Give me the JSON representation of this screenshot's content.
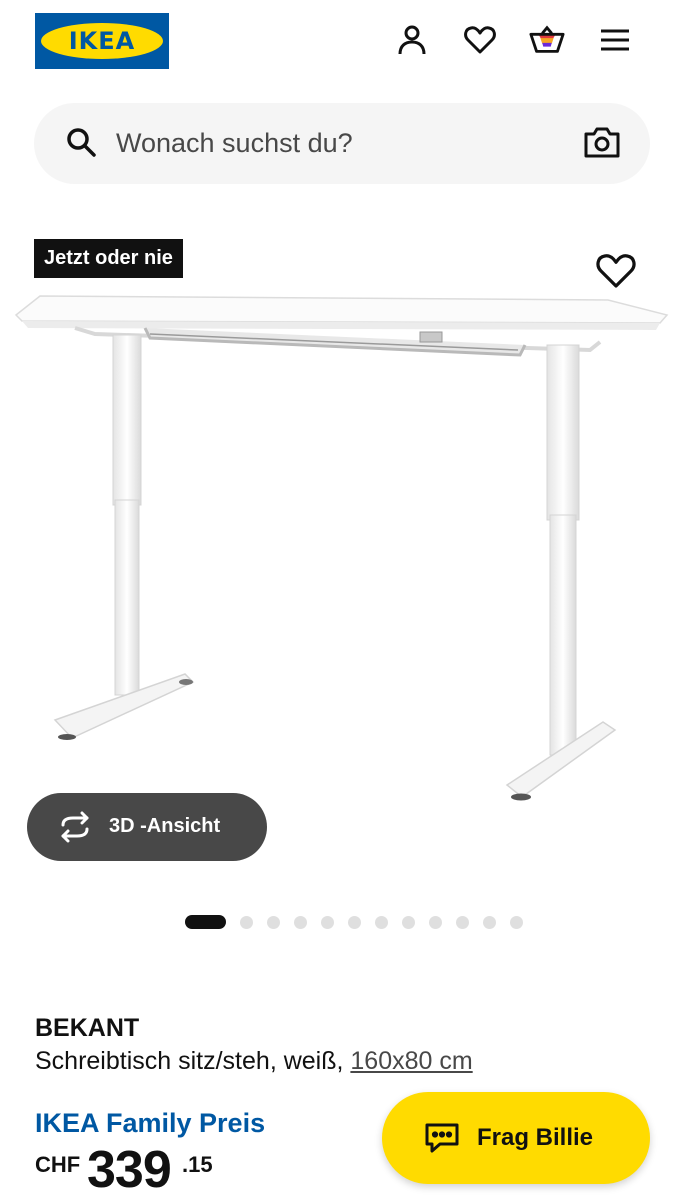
{
  "header": {
    "logo_text": "IKEA",
    "icons": [
      "account-icon",
      "wishlist-heart-icon",
      "cart-icon",
      "menu-icon"
    ]
  },
  "search": {
    "placeholder": "Wonach suchst du?"
  },
  "product": {
    "badge": "Jetzt oder nie",
    "name": "BEKANT",
    "description": "Schreibtisch sitz/steh, weiß, ",
    "size_link": "160x80 cm",
    "family_label": "IKEA Family Preis",
    "price": {
      "currency": "CHF",
      "integer": "339",
      "decimal": ".15"
    }
  },
  "view3d": {
    "label": "3D -Ansicht"
  },
  "gallery": {
    "total_images": 12,
    "active_index": 0
  },
  "chat": {
    "label": "Frag Billie"
  },
  "colors": {
    "ikea_blue": "#0058a3",
    "ikea_yellow": "#ffdb00",
    "dark_gray": "#484848"
  }
}
